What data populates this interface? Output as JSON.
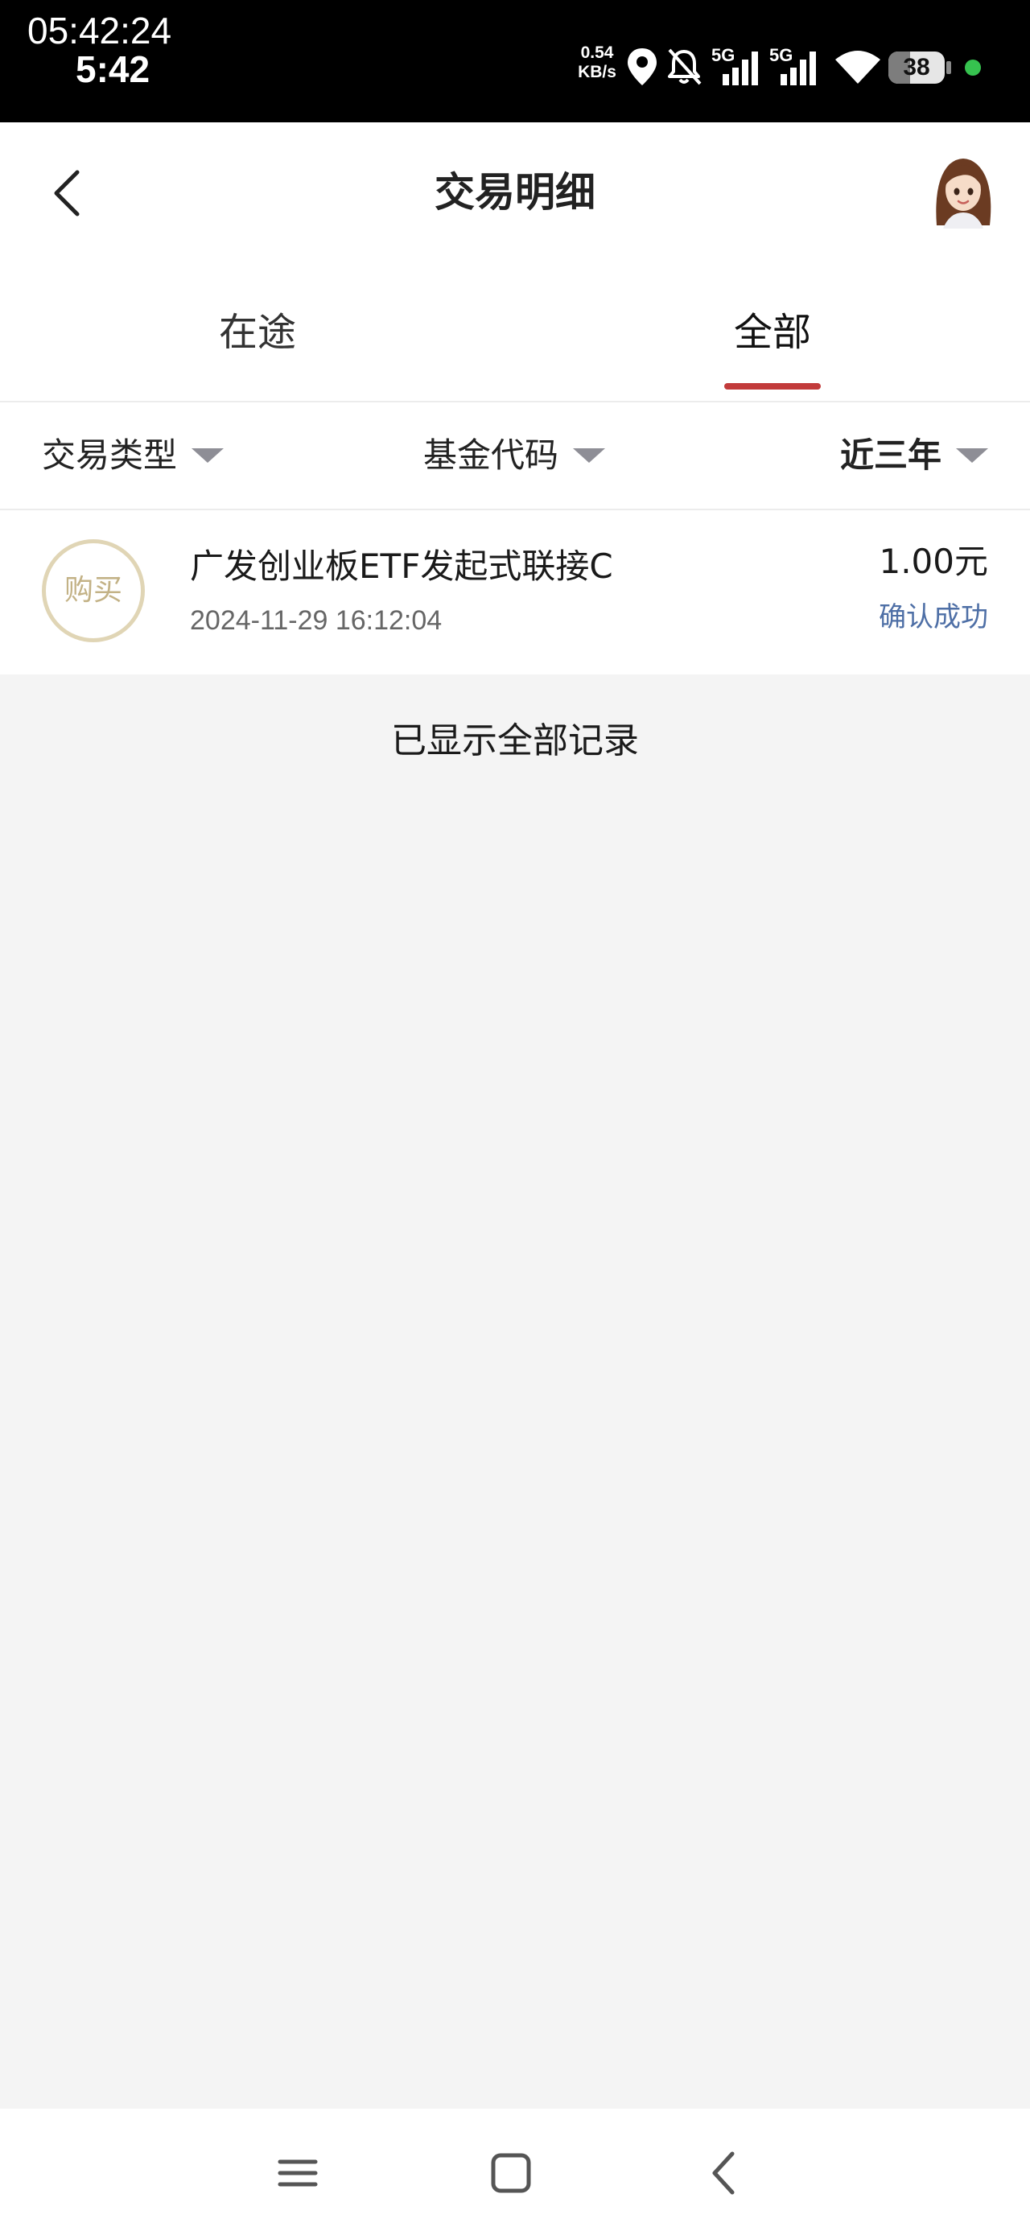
{
  "status_bar": {
    "clock_full": "05:42:24",
    "clock_short": "5:42",
    "net_speed_value": "0.54",
    "net_speed_unit": "KB/s",
    "network_1": "5G",
    "network_2": "5G",
    "battery_level": "38",
    "battery_fraction": 0.38,
    "dot_color": "#36c24f",
    "icons": [
      "location-icon",
      "bell-muted-icon",
      "signal-icon",
      "signal-icon",
      "wifi-icon",
      "battery-icon"
    ]
  },
  "header": {
    "title": "交易明细",
    "back_icon": "chevron-left-icon",
    "avatar_icon": "assistant-avatar"
  },
  "tabs": {
    "items": [
      {
        "label": "在途",
        "active": false
      },
      {
        "label": "全部",
        "active": true
      }
    ],
    "accent_color": "#c23b3b"
  },
  "filters": {
    "type_label": "交易类型",
    "code_label": "基金代码",
    "period_label": "近三年",
    "caret_icon": "caret-down-icon"
  },
  "transactions": [
    {
      "badge": "购买",
      "name": "广发创业板ETF发起式联接C",
      "time": "2024-11-29 16:12:04",
      "amount": "1.00元",
      "status": "确认成功"
    }
  ],
  "colors": {
    "badge_text": "#c3b286",
    "status_text": "#4e6fa6"
  },
  "list_end_note": "已显示全部记录",
  "nav_bar": {
    "icons": [
      "menu-icon",
      "home-square-icon",
      "back-chevron-icon"
    ]
  }
}
